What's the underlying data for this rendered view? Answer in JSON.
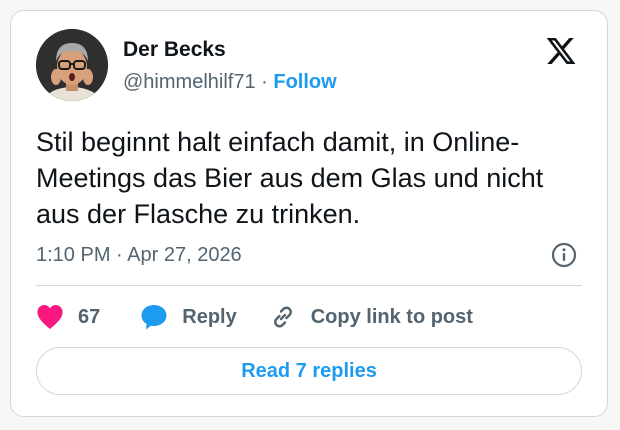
{
  "author": {
    "display_name": "Der Becks",
    "handle": "@himmelhilf71",
    "separator": "·",
    "follow_label": "Follow"
  },
  "tweet": {
    "text": "Stil beginnt halt einfach damit, in Online-Meetings das Bier aus dem Glas und nicht aus der Flasche zu trinken.",
    "timestamp": "1:10 PM · Apr 27, 2026"
  },
  "actions": {
    "like_count": "67",
    "reply_label": "Reply",
    "copy_link_label": "Copy link to post"
  },
  "read_replies_label": "Read 7 replies",
  "icons": {
    "brand": "x-logo-icon",
    "info": "info-icon",
    "like": "heart-icon",
    "reply": "speech-bubble-icon",
    "copy": "link-icon"
  },
  "colors": {
    "accent": "#1d9bf0",
    "like": "#f91880",
    "text": "#0f1419",
    "muted": "#536471",
    "border": "#cfd9de"
  }
}
